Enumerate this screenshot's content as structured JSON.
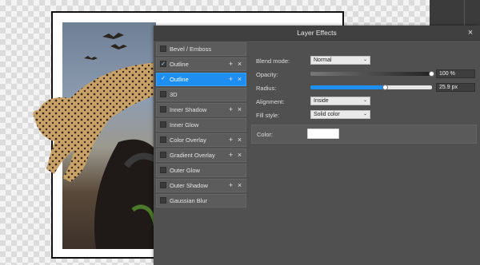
{
  "dialog": {
    "title": "Layer Effects"
  },
  "effects": [
    {
      "label": "Bevel / Emboss",
      "checked": false,
      "selected": false,
      "controls": false
    },
    {
      "label": "Outline",
      "checked": true,
      "selected": false,
      "controls": true
    },
    {
      "label": "Outline",
      "checked": true,
      "selected": true,
      "controls": true
    },
    {
      "label": "3D",
      "checked": false,
      "selected": false,
      "controls": false
    },
    {
      "label": "Inner Shadow",
      "checked": false,
      "selected": false,
      "controls": true
    },
    {
      "label": "Inner Glow",
      "checked": false,
      "selected": false,
      "controls": false
    },
    {
      "label": "Color Overlay",
      "checked": false,
      "selected": false,
      "controls": true
    },
    {
      "label": "Gradient Overlay",
      "checked": false,
      "selected": false,
      "controls": true
    },
    {
      "label": "Outer Glow",
      "checked": false,
      "selected": false,
      "controls": false
    },
    {
      "label": "Outer Shadow",
      "checked": false,
      "selected": false,
      "controls": true
    },
    {
      "label": "Gaussian Blur",
      "checked": false,
      "selected": false,
      "controls": false
    }
  ],
  "icons": {
    "add": "+",
    "delete": "×",
    "check": "✓",
    "close": "×",
    "chevron": "⌄"
  },
  "settings": {
    "blend_mode": {
      "label": "Blend mode:",
      "value": "Normal"
    },
    "opacity": {
      "label": "Opacity:",
      "value": "100 %",
      "level": 1.0
    },
    "radius": {
      "label": "Radius:",
      "value": "25.9 px",
      "level": 0.62
    },
    "alignment": {
      "label": "Alignment:",
      "value": "Inside"
    },
    "fill_style": {
      "label": "Fill style:",
      "value": "Solid color"
    },
    "color": {
      "label": "Color:",
      "value": "#ffffff"
    }
  },
  "colors": {
    "accent": "#1e8ff0",
    "dialog_bg": "#505050"
  }
}
